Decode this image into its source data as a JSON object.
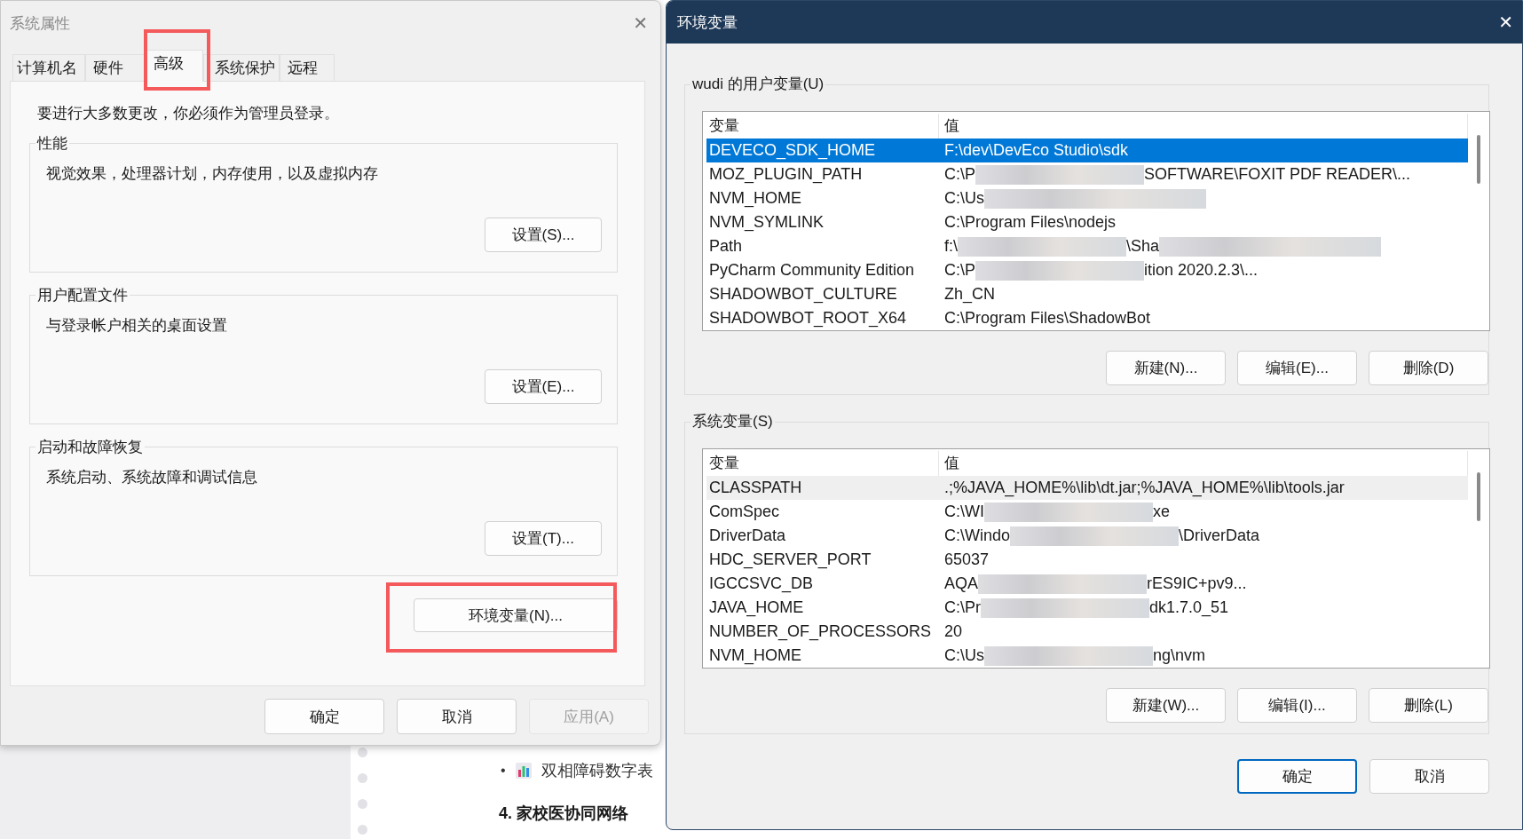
{
  "background_page": {
    "bullets": [
      {
        "kind": "chart",
        "text": "双相障碍数字表"
      }
    ],
    "heading": "4. 家校医协同网络",
    "bullet_mark": "•"
  },
  "system_properties": {
    "title": "系统属性",
    "close": "✕",
    "tabs": [
      {
        "label": "计算机名",
        "selected": false
      },
      {
        "label": "硬件",
        "selected": false
      },
      {
        "label": "高级",
        "selected": true
      },
      {
        "label": "系统保护",
        "selected": false
      },
      {
        "label": "远程",
        "selected": false
      }
    ],
    "notice": "要进行大多数更改，你必须作为管理员登录。",
    "groups": [
      {
        "title": "性能",
        "description": "视觉效果，处理器计划，内存使用，以及虚拟内存",
        "button": "设置(S)..."
      },
      {
        "title": "用户配置文件",
        "description": "与登录帐户相关的桌面设置",
        "button": "设置(E)..."
      },
      {
        "title": "启动和故障恢复",
        "description": "系统启动、系统故障和调试信息",
        "button": "设置(T)..."
      }
    ],
    "env_button": "环境变量(N)...",
    "buttons": [
      {
        "label": "确定",
        "disabled": false
      },
      {
        "label": "取消",
        "disabled": false
      },
      {
        "label": "应用(A)",
        "disabled": true
      }
    ]
  },
  "environment_variables": {
    "title": "环境变量",
    "close": "✕",
    "sections": [
      {
        "title": "wudi 的用户变量(U)",
        "focused": true,
        "columns": [
          "变量",
          "值"
        ],
        "rows": [
          {
            "variable": "DEVECO_SDK_HOME",
            "value_parts": [
              "F:\\dev\\DevEco Studio\\sdk"
            ],
            "redacted_end": false,
            "selected": true
          },
          {
            "variable": "MOZ_PLUGIN_PATH",
            "value_parts": [
              "C:\\P",
              "SOFTWARE\\FOXIT PDF READER\\..."
            ],
            "redacted_end": false,
            "selected": false
          },
          {
            "variable": "NVM_HOME",
            "value_parts": [
              "C:\\Us"
            ],
            "redacted_end": true,
            "selected": false
          },
          {
            "variable": "NVM_SYMLINK",
            "value_parts": [
              "C:\\Program Files\\nodejs"
            ],
            "redacted_end": false,
            "selected": false
          },
          {
            "variable": "Path",
            "value_parts": [
              "f:\\",
              "\\Sha"
            ],
            "redacted_end": true,
            "selected": false
          },
          {
            "variable": "PyCharm Community Edition",
            "value_parts": [
              "C:\\P",
              "ition 2020.2.3\\..."
            ],
            "redacted_end": false,
            "selected": false
          },
          {
            "variable": "SHADOWBOT_CULTURE",
            "value_parts": [
              "Zh_CN"
            ],
            "redacted_end": false,
            "selected": false
          },
          {
            "variable": "SHADOWBOT_ROOT_X64",
            "value_parts": [
              "C:\\Program Files\\ShadowBot"
            ],
            "redacted_end": false,
            "selected": false
          }
        ],
        "buttons": [
          "新建(N)...",
          "编辑(E)...",
          "删除(D)"
        ]
      },
      {
        "title": "系统变量(S)",
        "focused": false,
        "columns": [
          "变量",
          "值"
        ],
        "rows": [
          {
            "variable": "CLASSPATH",
            "value_parts": [
              ".;%JAVA_HOME%\\lib\\dt.jar;%JAVA_HOME%\\lib\\tools.jar"
            ],
            "redacted_end": false,
            "selected": true
          },
          {
            "variable": "ComSpec",
            "value_parts": [
              "C:\\WI",
              "xe"
            ],
            "redacted_end": false,
            "selected": false
          },
          {
            "variable": "DriverData",
            "value_parts": [
              "C:\\Windo",
              "\\DriverData"
            ],
            "redacted_end": false,
            "selected": false
          },
          {
            "variable": "HDC_SERVER_PORT",
            "value_parts": [
              "65037"
            ],
            "redacted_end": false,
            "selected": false
          },
          {
            "variable": "IGCCSVC_DB",
            "value_parts": [
              "AQA",
              "rES9IC+pv9..."
            ],
            "redacted_end": false,
            "selected": false
          },
          {
            "variable": "JAVA_HOME",
            "value_parts": [
              "C:\\Pr",
              "dk1.7.0_51"
            ],
            "redacted_end": false,
            "selected": false
          },
          {
            "variable": "NUMBER_OF_PROCESSORS",
            "value_parts": [
              "20"
            ],
            "redacted_end": false,
            "selected": false
          },
          {
            "variable": "NVM_HOME",
            "value_parts": [
              "C:\\Us",
              "ng\\nvm"
            ],
            "redacted_end": false,
            "selected": false
          }
        ],
        "buttons": [
          "新建(W)...",
          "编辑(I)...",
          "删除(L)"
        ]
      }
    ],
    "buttons": [
      {
        "label": "确定",
        "default": true
      },
      {
        "label": "取消",
        "default": false
      }
    ]
  }
}
